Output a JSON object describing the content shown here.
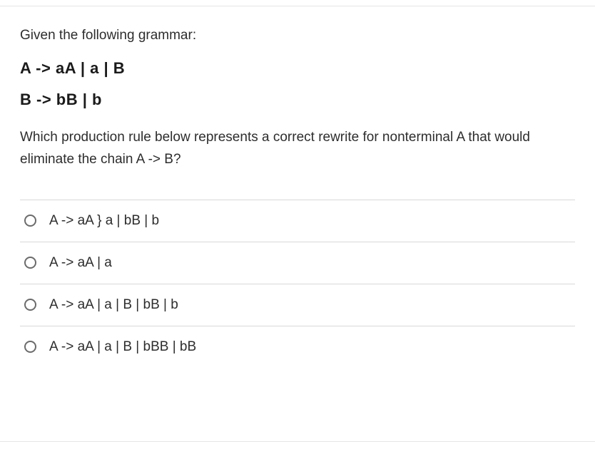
{
  "question": {
    "intro": "Given the following grammar:",
    "grammar_rule_1": "A -> aA | a | B",
    "grammar_rule_2": "B -> bB | b",
    "prompt": "Which production rule below represents a correct rewrite for nonterminal A that would eliminate the chain A -> B?"
  },
  "options": [
    {
      "label": "A -> aA } a | bB | b"
    },
    {
      "label": "A -> aA | a"
    },
    {
      "label": "A -> aA | a | B | bB | b"
    },
    {
      "label": "A -> aA | a | B | bBB | bB"
    }
  ]
}
